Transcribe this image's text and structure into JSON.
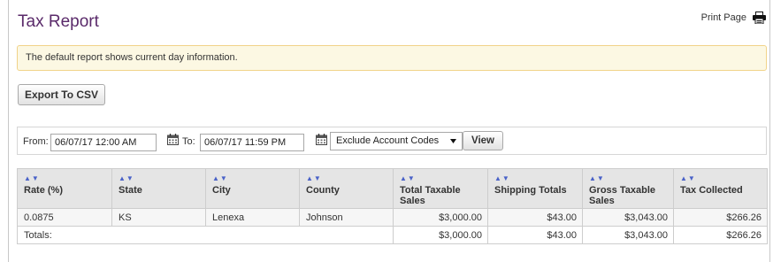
{
  "page": {
    "title": "Tax Report",
    "print_label": "Print Page",
    "alert": "The default report shows current day information.",
    "export_label": "Export To CSV"
  },
  "filters": {
    "from_label": "From:",
    "from_value": "06/07/17 12:00 AM",
    "to_label": "To:",
    "to_value": "06/07/17 11:59 PM",
    "account_codes_selected": "Exclude Account Codes",
    "view_label": "View"
  },
  "table": {
    "sort_glyph": "▲▼",
    "headers": {
      "rate": "Rate (%)",
      "state": "State",
      "city": "City",
      "county": "County",
      "total_taxable_sales": "Total Taxable Sales",
      "shipping_totals": "Shipping Totals",
      "gross_taxable_sales": "Gross Taxable Sales",
      "tax_collected": "Tax Collected"
    },
    "rows": [
      {
        "rate": "0.0875",
        "state": "KS",
        "city": "Lenexa",
        "county": "Johnson",
        "total_taxable_sales": "$3,000.00",
        "shipping_totals": "$43.00",
        "gross_taxable_sales": "$3,043.00",
        "tax_collected": "$266.26"
      }
    ],
    "totals": {
      "label": "Totals:",
      "total_taxable_sales": "$3,000.00",
      "shipping_totals": "$43.00",
      "gross_taxable_sales": "$3,043.00",
      "tax_collected": "$266.26"
    }
  },
  "colors": {
    "title": "#5a2a6a",
    "alert_bg": "#fcf8e3",
    "alert_border": "#f1d389",
    "sort_arrows": "#4a62c8"
  },
  "icons": {
    "print": "printer-icon",
    "calendar": "calendar-icon",
    "select_arrow": "triangle-down-icon",
    "sort": "sort-arrows-icon"
  }
}
